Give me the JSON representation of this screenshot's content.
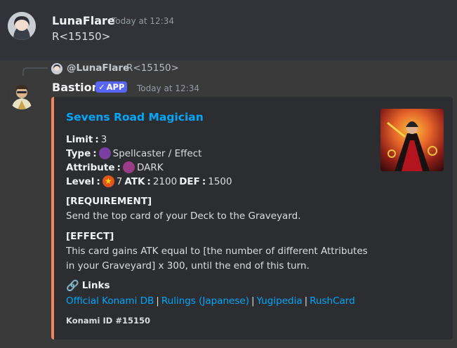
{
  "message1": {
    "username": "LunaFlare",
    "timestamp": "Today at 12:34",
    "content": "R<15150>"
  },
  "message2": {
    "reply": {
      "username": "@LunaFlare",
      "content": "R<15150>"
    },
    "username": "Bastion",
    "badge": "APP",
    "timestamp": "Today at 12:34",
    "embed": {
      "accent_color": "#f0845a",
      "title": "Sevens Road Magician",
      "limit_label": "Limit",
      "limit_value": "3",
      "type_label": "Type",
      "type_value": "Spellcaster / Effect",
      "attribute_label": "Attribute",
      "attribute_value": "DARK",
      "level_label": "Level",
      "level_value": "7",
      "atk_label": "ATK",
      "atk_value": "2100",
      "def_label": "DEF",
      "def_value": "1500",
      "requirement_heading": "[REQUIREMENT]",
      "requirement_text": "Send the top card of your Deck to the Graveyard.",
      "effect_heading": "[EFFECT]",
      "effect_text": "This card gains ATK equal to [the number of different Attributes in your Graveyard] x 300, until the end of this turn.",
      "links_heading": "Links",
      "links": [
        "Official Konami DB",
        "Rulings (Japanese)",
        "Yugipedia",
        "RushCard"
      ],
      "footer": "Konami ID #15150"
    }
  }
}
